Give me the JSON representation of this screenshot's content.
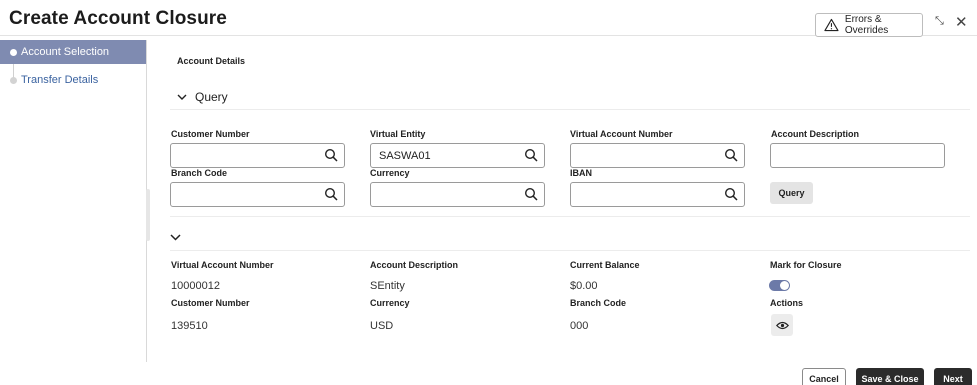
{
  "header": {
    "title": "Create Account Closure",
    "errors_button_label": "Errors & Overrides"
  },
  "sidebar": {
    "steps": [
      {
        "label": "Account Selection",
        "active": true
      },
      {
        "label": "Transfer Details",
        "active": false
      }
    ]
  },
  "main": {
    "section_title": "Account Details",
    "query_toggle_label": "Query",
    "query_fields": [
      {
        "label": "Customer Number",
        "value": ""
      },
      {
        "label": "Virtual Entity",
        "value": "SASWA01"
      },
      {
        "label": "Virtual Account Number",
        "value": ""
      },
      {
        "label": "Account Description",
        "value": ""
      },
      {
        "label": "Branch Code",
        "value": ""
      },
      {
        "label": "Currency",
        "value": ""
      },
      {
        "label": "IBAN",
        "value": ""
      }
    ],
    "query_button_label": "Query",
    "results": {
      "row1_labels": [
        "Virtual Account Number",
        "Account Description",
        "Current Balance",
        "Mark for Closure"
      ],
      "row1_values": [
        "10000012",
        "SEntity",
        "$0.00"
      ],
      "row2_labels": [
        "Customer Number",
        "Currency",
        "Branch Code",
        "Actions"
      ],
      "row2_values": [
        "139510",
        "USD",
        "000"
      ],
      "mark_for_closure": true
    }
  },
  "footer": {
    "cancel_label": "Cancel",
    "save_close_label": "Save & Close",
    "next_label": "Next"
  },
  "colors": {
    "active_step_bg": "#7f8bb1",
    "toggle_on": "#6c7aa8",
    "primary_button": "#2b2b2b",
    "link_text": "#3b63a0"
  }
}
